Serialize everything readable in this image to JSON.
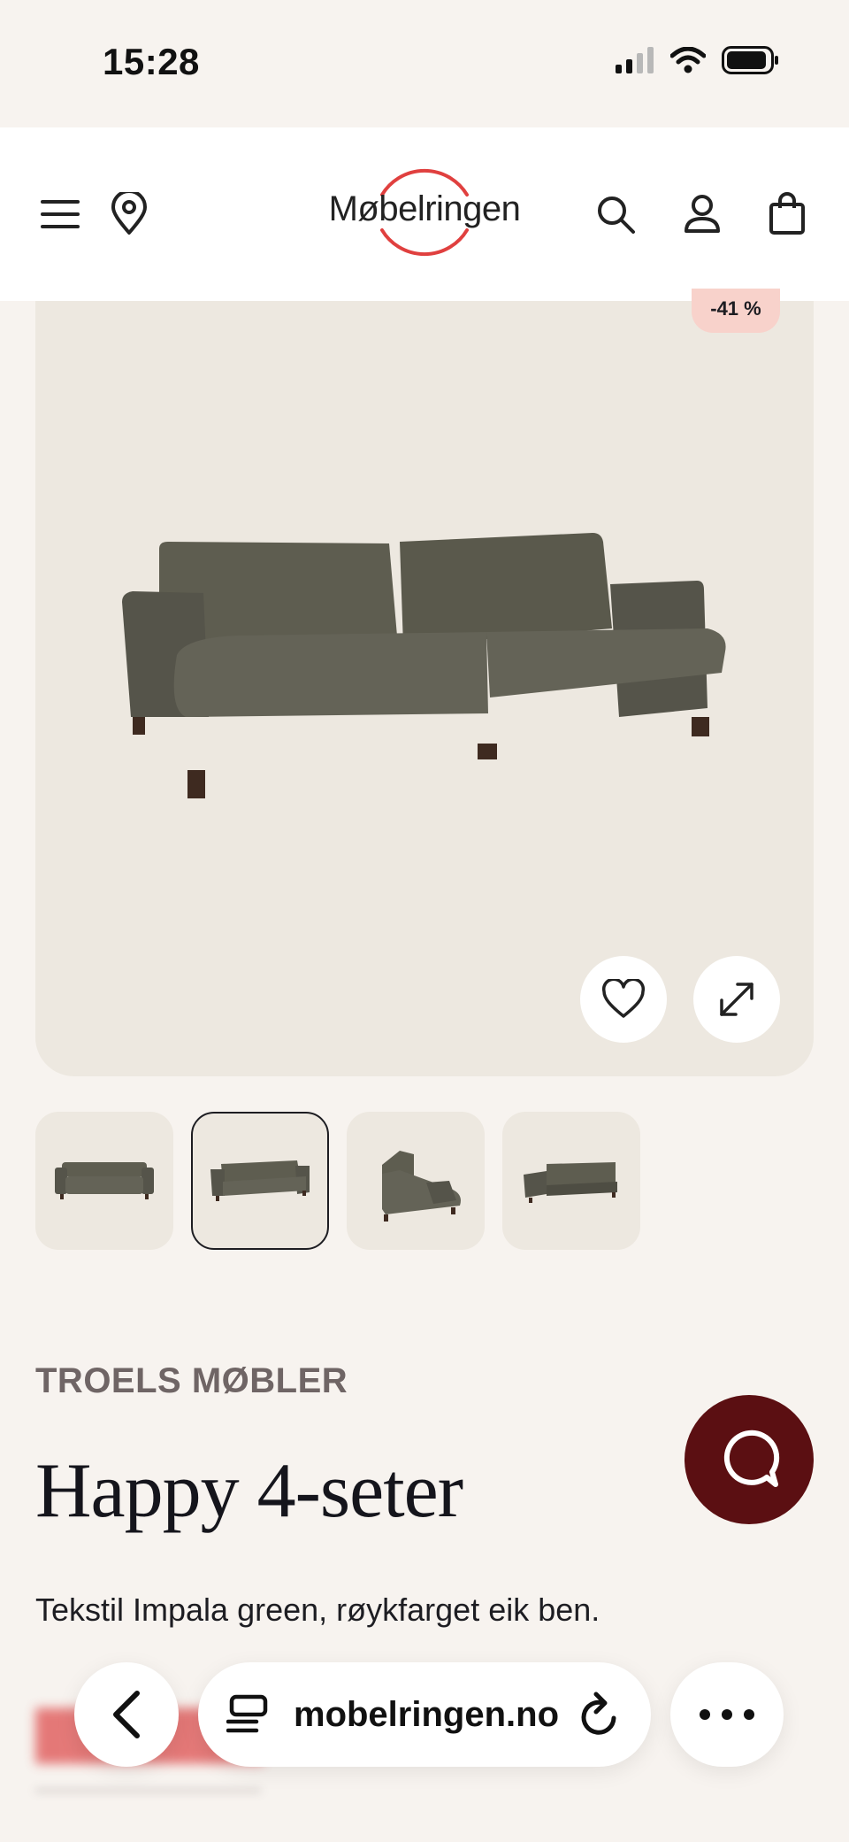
{
  "status_bar": {
    "time": "15:28"
  },
  "header": {
    "logo_text": "Møbelringen",
    "accent_color": "#e0403f",
    "icons": [
      "menu-icon",
      "location-pin-icon",
      "search-icon",
      "user-icon",
      "shopping-bag-icon"
    ]
  },
  "product": {
    "discount_badge": "-41 %",
    "brand": "TROELS MØBLER",
    "name": "Happy 4-seter",
    "description": "Tekstil Impala green, røykfarget eik ben.",
    "thumbnail_count": 4,
    "selected_thumbnail": 2
  },
  "browser": {
    "url": "mobelringen.no"
  },
  "colors": {
    "background": "#f7f3ef",
    "image_bg": "#ede8e0",
    "chat_button": "#5b0f12",
    "sofa": "#5e5d50"
  }
}
